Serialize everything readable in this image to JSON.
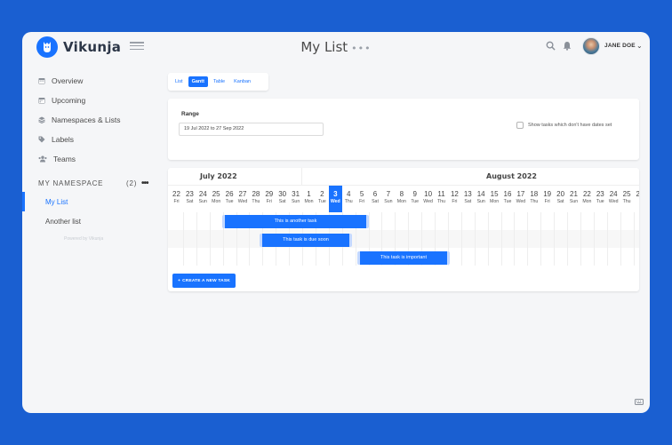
{
  "app": {
    "name": "Vikunja"
  },
  "header": {
    "title": "My List",
    "title_menu": "•••",
    "user_name": "JANE DOE"
  },
  "sidebar": {
    "items": [
      {
        "label": "Overview",
        "icon": "calendar-icon"
      },
      {
        "label": "Upcoming",
        "icon": "calendar-icon"
      },
      {
        "label": "Namespaces & Lists",
        "icon": "layers-icon"
      },
      {
        "label": "Labels",
        "icon": "tags-icon"
      },
      {
        "label": "Teams",
        "icon": "users-icon"
      }
    ],
    "namespace": {
      "label": "MY NAMESPACE",
      "count": "(2)",
      "menu": "•••"
    },
    "lists": [
      {
        "label": "My List",
        "active": true
      },
      {
        "label": "Another list",
        "active": false
      }
    ],
    "powered_by": "Powered by Vikunja"
  },
  "views": {
    "tabs": [
      "List",
      "Gantt",
      "Table",
      "Kanban"
    ],
    "active": "Gantt"
  },
  "range": {
    "label": "Range",
    "value": "19 Jul 2022 to 27 Sep 2022",
    "show_undated_label": "Show tasks which don't have dates set",
    "show_undated_checked": false
  },
  "gantt": {
    "months": [
      "July 2022",
      "August 2022"
    ],
    "days": [
      {
        "num": "22",
        "wd": "Fri"
      },
      {
        "num": "23",
        "wd": "Sat"
      },
      {
        "num": "24",
        "wd": "Sun"
      },
      {
        "num": "25",
        "wd": "Mon"
      },
      {
        "num": "26",
        "wd": "Tue"
      },
      {
        "num": "27",
        "wd": "Wed"
      },
      {
        "num": "28",
        "wd": "Thu"
      },
      {
        "num": "29",
        "wd": "Fri"
      },
      {
        "num": "30",
        "wd": "Sat"
      },
      {
        "num": "31",
        "wd": "Sun"
      },
      {
        "num": "1",
        "wd": "Mon"
      },
      {
        "num": "2",
        "wd": "Tue"
      },
      {
        "num": "3",
        "wd": "Wed",
        "today": true
      },
      {
        "num": "4",
        "wd": "Thu"
      },
      {
        "num": "5",
        "wd": "Fri"
      },
      {
        "num": "6",
        "wd": "Sat"
      },
      {
        "num": "7",
        "wd": "Sun"
      },
      {
        "num": "8",
        "wd": "Mon"
      },
      {
        "num": "9",
        "wd": "Tue"
      },
      {
        "num": "10",
        "wd": "Wed"
      },
      {
        "num": "11",
        "wd": "Thu"
      },
      {
        "num": "12",
        "wd": "Fri"
      },
      {
        "num": "13",
        "wd": "Sat"
      },
      {
        "num": "14",
        "wd": "Sun"
      },
      {
        "num": "15",
        "wd": "Mon"
      },
      {
        "num": "16",
        "wd": "Tue"
      },
      {
        "num": "17",
        "wd": "Wed"
      },
      {
        "num": "18",
        "wd": "Thu"
      },
      {
        "num": "19",
        "wd": "Fri"
      },
      {
        "num": "20",
        "wd": "Sat"
      },
      {
        "num": "21",
        "wd": "Sun"
      },
      {
        "num": "22",
        "wd": "Mon"
      },
      {
        "num": "23",
        "wd": "Tue"
      },
      {
        "num": "24",
        "wd": "Wed"
      },
      {
        "num": "25",
        "wd": "Thu"
      },
      {
        "num": "26",
        "wd": ""
      }
    ],
    "tasks": [
      {
        "title": "This is another task",
        "start": "26 Jul 2022",
        "end": "5 Aug 2022"
      },
      {
        "title": "This task is due soon",
        "start": "29 Jul 2022",
        "end": "4 Aug 2022"
      },
      {
        "title": "This task is important",
        "start": "6 Aug 2022",
        "end": "11 Aug 2022"
      }
    ],
    "create_label": "CREATE A NEW TASK"
  },
  "colors": {
    "primary": "#1973ff",
    "background": "#1a5fd1"
  }
}
